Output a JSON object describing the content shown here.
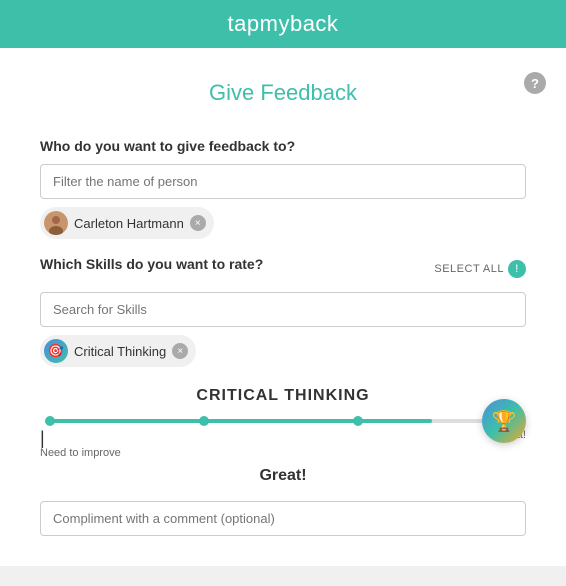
{
  "header": {
    "logo": "tapmyback"
  },
  "page": {
    "title": "Give Feedback",
    "help_icon": "?"
  },
  "form": {
    "recipient_label": "Who do you want to give feedback to?",
    "recipient_placeholder": "Filter the name of person",
    "recipient_name": "Carleton Hartmann",
    "skills_label": "Which Skills do you want to rate?",
    "select_all_label": "SELECT ALL",
    "skills_placeholder": "Search for Skills",
    "selected_skill": "Critical Thinking",
    "skill_title": "CRITICAL THINKING",
    "slider_left_label": "Need to improve",
    "slider_right_label": "Great!",
    "rating_value": "Great!",
    "comment_placeholder": "Compliment with a comment (optional)"
  },
  "icons": {
    "help": "?",
    "close": "×",
    "info": "!"
  }
}
